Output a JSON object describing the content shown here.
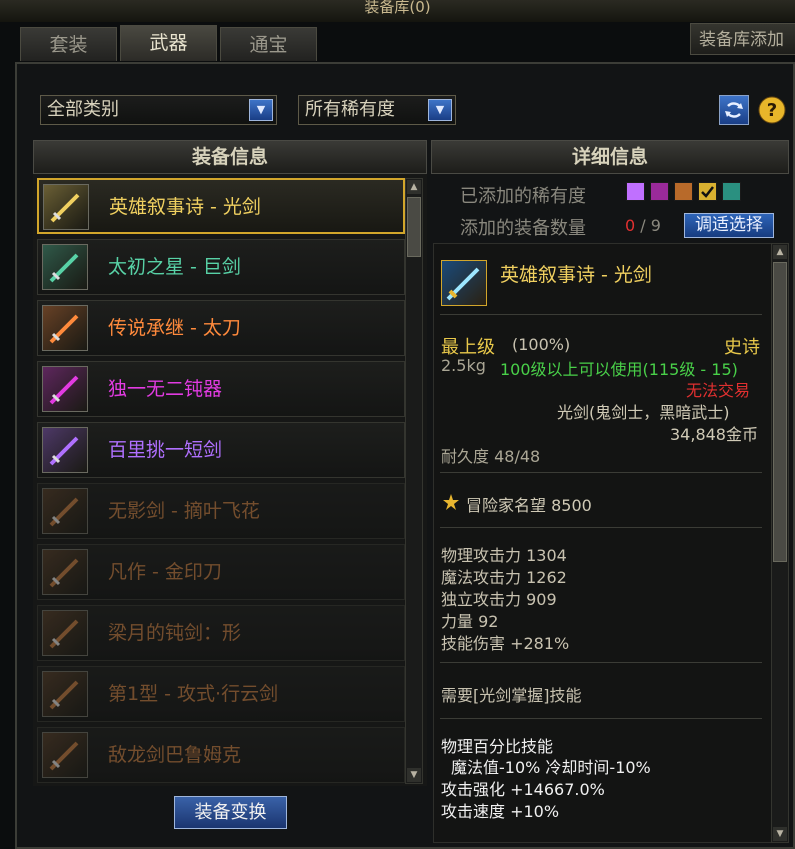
{
  "window": {
    "title": "装备库(0)"
  },
  "tabs": [
    {
      "label": "套装"
    },
    {
      "label": "武器"
    },
    {
      "label": "通宝"
    }
  ],
  "add_tab": "装备库添加",
  "filters": {
    "category": "全部类别",
    "rarity": "所有稀有度"
  },
  "list_header": "装备信息",
  "detail_header": "详细信息",
  "items": [
    {
      "name": "英雄叙事诗 - 光剑",
      "color": "#f0d060",
      "selected": true
    },
    {
      "name": "太初之星 - 巨剑",
      "color": "#58d2a6"
    },
    {
      "name": "传说承继 - 太刀",
      "color": "#ff8a3c"
    },
    {
      "name": "独一无二钝器",
      "color": "#e23be2"
    },
    {
      "name": "百里挑一短剑",
      "color": "#b070ff"
    },
    {
      "name": "无影剑 - 摘叶飞花",
      "color": "#c07a40",
      "dim": true
    },
    {
      "name": "凡作 - 金印刀",
      "color": "#c07a40",
      "dim": true
    },
    {
      "name": "梁月的钝剑：形",
      "color": "#c07a40",
      "dim": true
    },
    {
      "name": "第1型 - 攻式·行云剑",
      "color": "#c07a40",
      "dim": true
    },
    {
      "name": "敌龙剑巴鲁姆克",
      "color": "#c07a40",
      "dim": true
    }
  ],
  "convert_button": "装备变换",
  "rarity_added_label": "已添加的稀有度",
  "rarity_swatches": [
    "#c070ff",
    "#9a2a9a",
    "#b86a2a",
    "#d8b030",
    "#2a9080"
  ],
  "count_label": "添加的装备数量",
  "count": {
    "current": "0",
    "sep": "/",
    "max": "9"
  },
  "pick_button": "调适选择",
  "detail": {
    "name": "英雄叙事诗 - 光剑",
    "grade": "最上级",
    "grade_pct": "(100%)",
    "rarity": "史诗",
    "weight": "2.5kg",
    "level_req": "100级以上可以使用(115级 - 15)",
    "trade": "无法交易",
    "type_line": "光剑(鬼剑士，黑暗武士)",
    "price": "34,848金币",
    "durability": "耐久度 48/48",
    "fame": "冒险家名望 8500",
    "stats": [
      "物理攻击力 1304",
      "魔法攻击力 1262",
      "独立攻击力 909",
      "力量 92",
      "技能伤害 +281%"
    ],
    "req_skill": "需要[光剑掌握]技能",
    "skill_title": "物理百分比技能",
    "skill_lines": [
      "魔法值-10% 冷却时间-10%",
      "攻击强化 +14667.0%",
      "攻击速度 +10%"
    ]
  }
}
